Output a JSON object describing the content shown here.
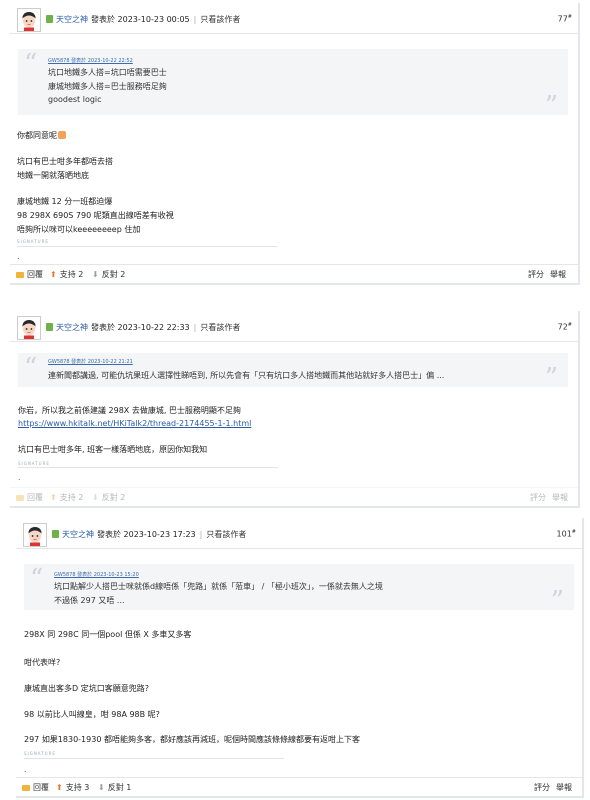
{
  "posts": [
    {
      "author": "天空之神",
      "posted": "發表於 2023-10-23 00:05",
      "only_author": "只看該作者",
      "floor": "77",
      "floor_mark": "#",
      "quote": {
        "author": "GW5878 發表於 2023-10-22 22:52",
        "lines": [
          "坑口地鐵多人搭=坑口唔需要巴士",
          "康城地鐵多人搭=巴士服務唔足夠",
          "goodest logic"
        ]
      },
      "body": [
        "你都同意呢",
        "坑口有巴士咁多年都唔去搭",
        "地鐵一開就落晒地底",
        "康城地鐵 12 分一班都迫爆",
        "98 298X 690S 790 呢類直出線唔差有收視",
        "唔夠所以咪可以keeeeeeeep 住加"
      ],
      "signature_label": "SIGNATURE",
      "dot": ".",
      "actions": {
        "reply": "回覆",
        "support": "支持 2",
        "oppose": "反對 2",
        "rate": "評分",
        "report": "舉報"
      }
    },
    {
      "author": "天空之神",
      "posted": "發表於 2023-10-22 22:33",
      "only_author": "只看該作者",
      "floor": "72",
      "floor_mark": "#",
      "quote": {
        "author": "GW5878 發表於 2023-10-22 21:21",
        "lines": [
          "連新聞都講過, 可能仇坑果班人選擇性睇唔到, 所以先會有「只有坑口多人搭地鐵而其他站就好多人搭巴士」偏 ..."
        ]
      },
      "body": [
        "你岩，所以我之前係建議 298X 去做康城, 巴士服務明顯不足夠",
        "https://www.hkitalk.net/HKiTalk2/thread-2174455-1-1.html",
        "坑口有巴士咁多年, 班客一樣落晒地底，原因你知我知"
      ],
      "signature_label": "SIGNATURE",
      "dot": ".",
      "actions": {
        "reply": "回覆",
        "support": "支持 2",
        "oppose": "反對 2",
        "rate": "評分",
        "report": "舉報"
      }
    },
    {
      "author": "天空之神",
      "posted": "發表於 2023-10-23 17:23",
      "only_author": "只看該作者",
      "floor": "101",
      "floor_mark": "#",
      "quote": {
        "author": "GW5878 發表於 2023-10-23 15:20",
        "lines": [
          "坑口點解少人搭巴士咪就係d線唔係「兜路」就係「蒞車」 / 「極小班次」，一係就去無人之境",
          "不過係 297 又唔 ..."
        ]
      },
      "body": [
        "298X 同 298C 同一個pool 但係 X 多車又多客",
        "咁代表咩?",
        "康城直出客多D 定坑口客願意兜路?",
        "98 以前比人叫線皇，咁 98A 98B 呢?",
        "297 如果1830-1930 都唔能夠多客，都好應該再減班，呢個時間應該條條線都要有返咁上下客"
      ],
      "signature_label": "SIGNATURE",
      "dot": ".",
      "actions": {
        "reply": "回覆",
        "support": "支持 3",
        "oppose": "反對 1",
        "rate": "評分",
        "report": "舉報"
      }
    }
  ],
  "colors": {
    "accent_link": "#2a5aa8",
    "support_icon": "#e8792b",
    "quote_bg": "#f4f5f7"
  }
}
